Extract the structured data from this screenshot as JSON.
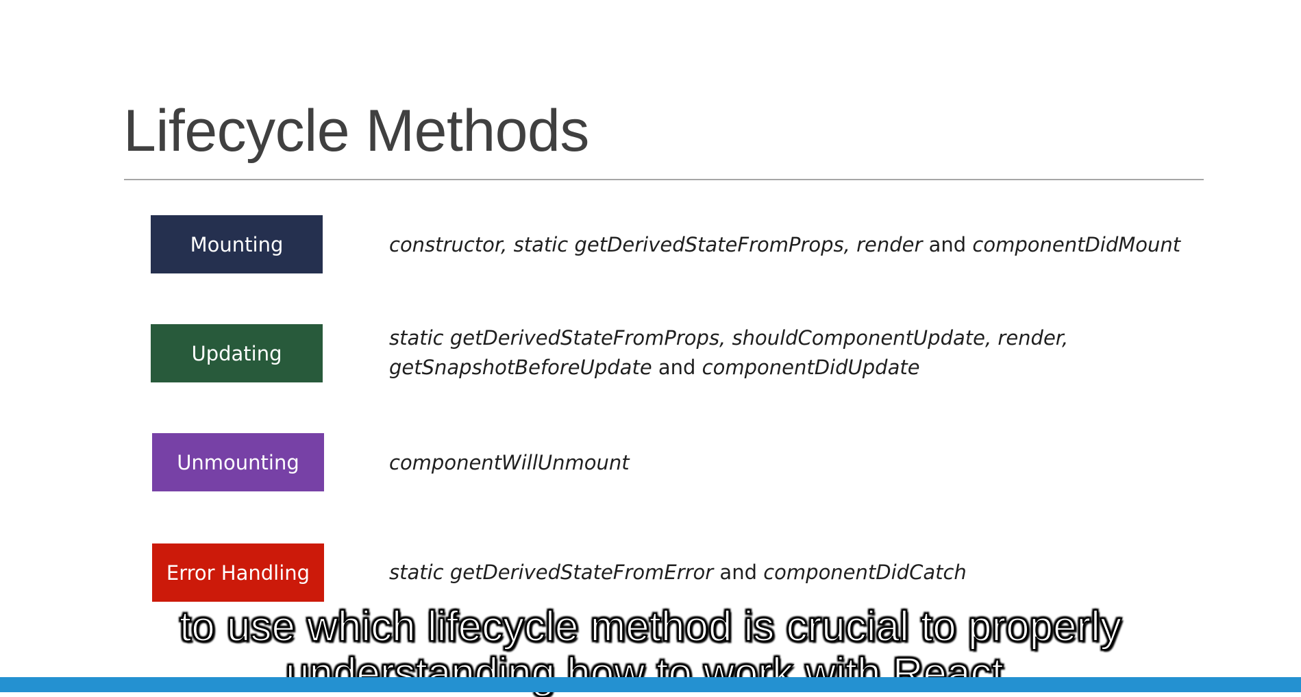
{
  "slide": {
    "title": "Lifecycle Methods",
    "rows": [
      {
        "label": "Mounting",
        "color": "#25304f",
        "parts": [
          {
            "text": "constructor, static getDerivedStateFromProps, render",
            "italic": true
          },
          {
            "text": " and ",
            "italic": false
          },
          {
            "text": "componentDidMount",
            "italic": true
          }
        ]
      },
      {
        "label": "Updating",
        "color": "#285a3b",
        "parts": [
          {
            "text": "static getDerivedStateFromProps, shouldComponentUpdate, render,",
            "italic": true
          },
          {
            "text": "\n",
            "italic": false
          },
          {
            "text": "getSnapshotBeforeUpdate",
            "italic": true
          },
          {
            "text": " and ",
            "italic": false
          },
          {
            "text": "componentDidUpdate",
            "italic": true
          }
        ]
      },
      {
        "label": "Unmounting",
        "color": "#7741a6",
        "parts": [
          {
            "text": "componentWillUnmount",
            "italic": true
          }
        ]
      },
      {
        "label": "Error Handling",
        "color": "#cc1a0a",
        "parts": [
          {
            "text": "static getDerivedStateFromError",
            "italic": true
          },
          {
            "text": " and ",
            "italic": false
          },
          {
            "text": "componentDidCatch",
            "italic": true
          }
        ]
      }
    ]
  },
  "subtitle": {
    "line1": "to use which lifecycle method is crucial to properly",
    "line2": "understanding how to work with React."
  },
  "colors": {
    "title": "#404040",
    "rule": "#a6a6a6",
    "progress": "#2491d1"
  }
}
